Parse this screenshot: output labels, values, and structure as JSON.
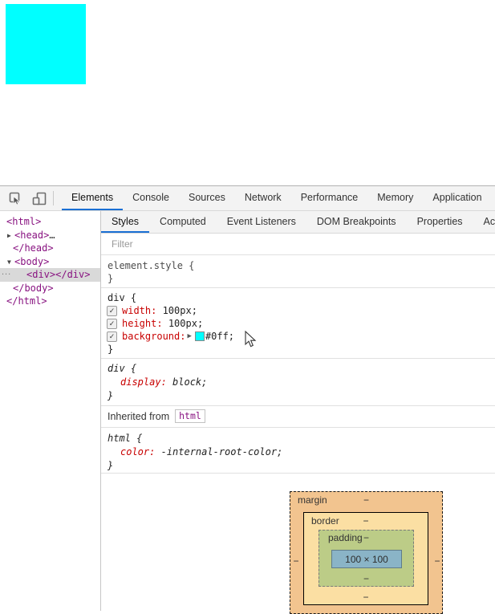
{
  "page": {
    "square_color": "#00ffff"
  },
  "icons": {
    "tree_collapsed": "▶",
    "tree_expanded": "▼",
    "checkbox_check": "✓",
    "expand_arrow": "▶",
    "menu_dots": "..."
  },
  "toolbar": {
    "tabs": [
      "Elements",
      "Console",
      "Sources",
      "Network",
      "Performance",
      "Memory",
      "Application"
    ],
    "selected": "Elements"
  },
  "sidebar_tabs": {
    "tabs": [
      "Styles",
      "Computed",
      "Event Listeners",
      "DOM Breakpoints",
      "Properties",
      "Accessibility"
    ],
    "selected": "Styles"
  },
  "dom_tree": {
    "rows": [
      {
        "text": "<html>"
      },
      {
        "text": "<head>",
        "suffix": "…",
        "expanded": false
      },
      {
        "text": "</head>"
      },
      {
        "text": "<body>",
        "expanded": true
      },
      {
        "text": "<div></div>",
        "selected": true
      },
      {
        "text": "</body>"
      },
      {
        "text": "</html>"
      }
    ]
  },
  "styles_pane": {
    "filter_placeholder": "Filter",
    "element_style": {
      "selector": "element.style {",
      "close": "}"
    },
    "rule_div": {
      "selector": "div {",
      "close": "}",
      "props": [
        {
          "name": "width",
          "value": " 100px;",
          "colon": ":"
        },
        {
          "name": "height",
          "value": " 100px;",
          "colon": ":"
        },
        {
          "name": "background",
          "value": "#0ff;",
          "colon": ":",
          "swatch": "#0ff"
        }
      ]
    },
    "rule_div_ua": {
      "selector": "div {",
      "close": "}",
      "props": [
        {
          "name": "display",
          "value": " block;",
          "colon": ":"
        }
      ]
    },
    "inherited": {
      "label": "Inherited from",
      "tag": "html"
    },
    "rule_html": {
      "selector": "html {",
      "close": "}",
      "props": [
        {
          "name": "color",
          "value": " -internal-root-color;",
          "colon": ":"
        }
      ]
    }
  },
  "box_model": {
    "margin_label": "margin",
    "border_label": "border",
    "padding_label": "padding",
    "content": "100 × 100",
    "dash": "−",
    "colors": {
      "margin": "#f2c48f",
      "border": "#fbdfa3",
      "padding": "#bccc87",
      "content": "#8ab4c7"
    }
  }
}
